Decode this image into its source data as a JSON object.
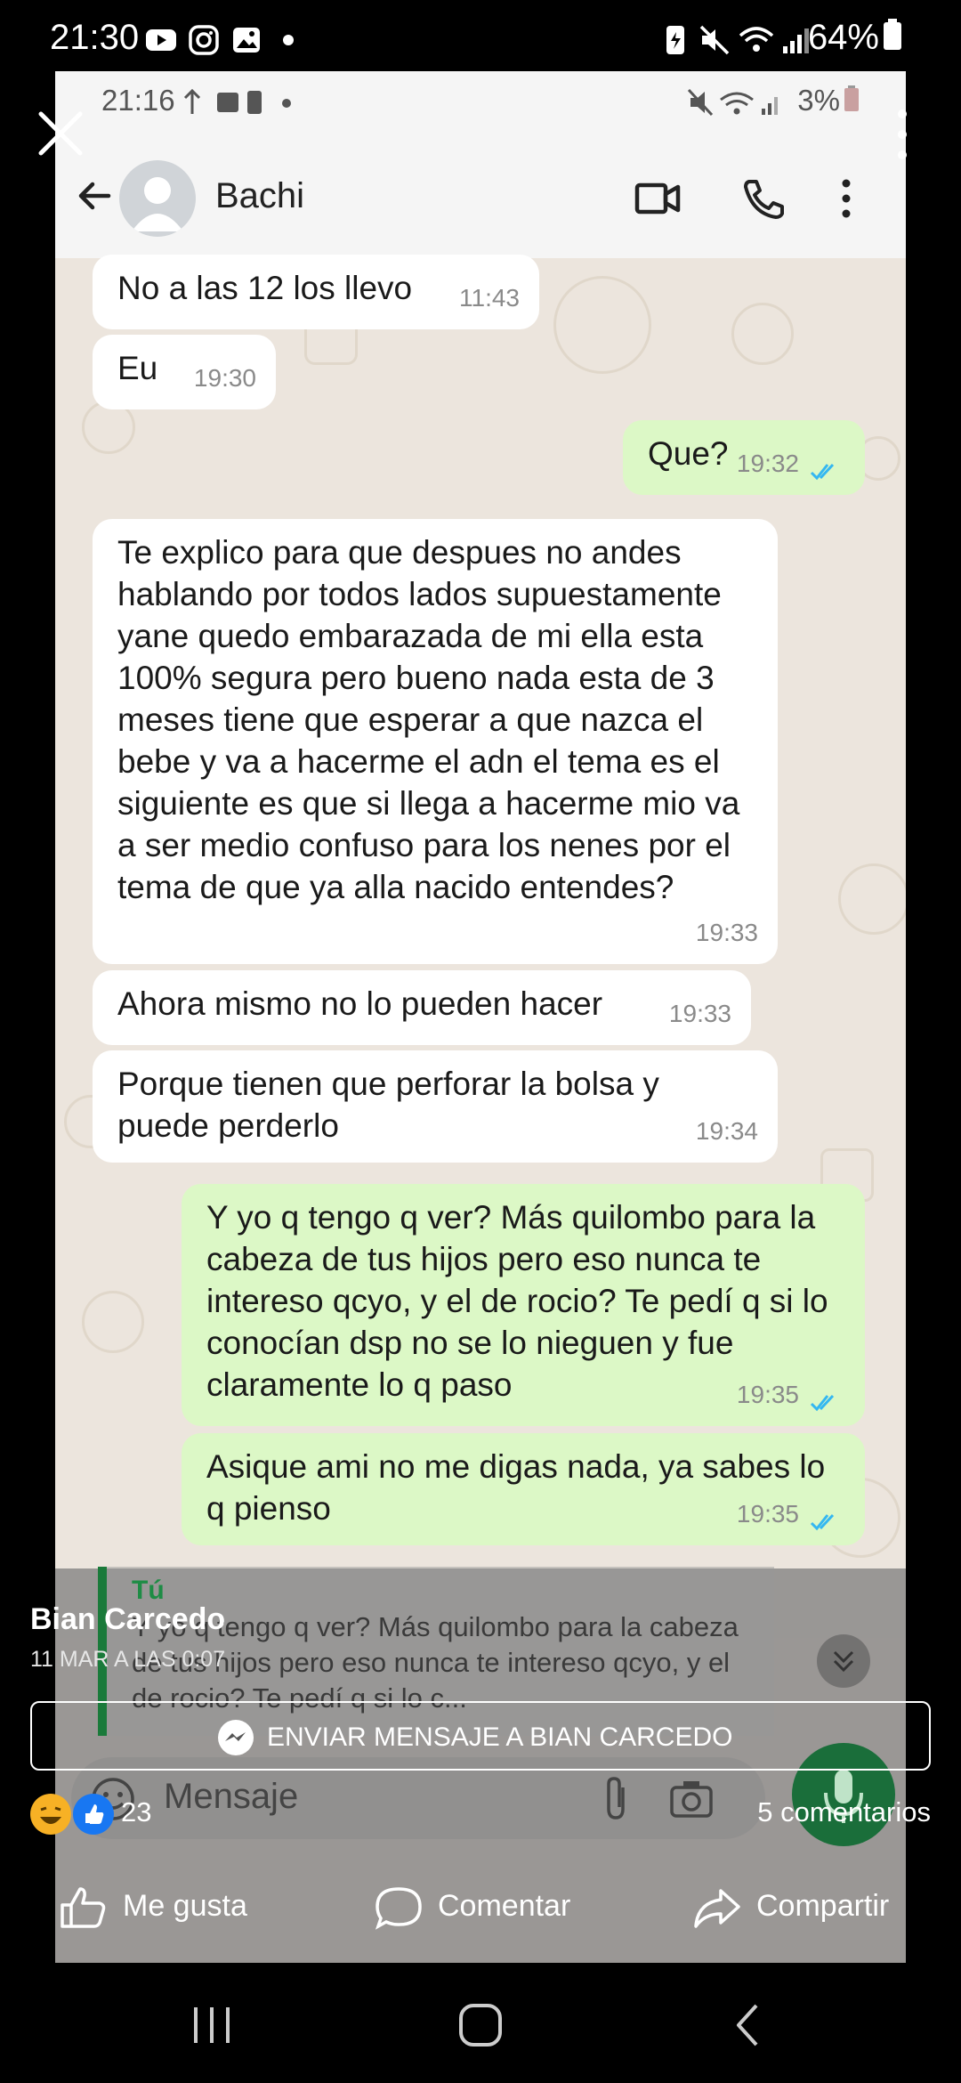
{
  "outer_status": {
    "time": "21:30",
    "battery": "64%"
  },
  "inner_status": {
    "time": "21:16",
    "battery": "3%"
  },
  "chat": {
    "contact_name": "Bachi"
  },
  "messages": [
    {
      "dir": "in",
      "text": "No a las 12 los llevo",
      "time": "11:43"
    },
    {
      "dir": "in",
      "text": "Eu",
      "time": "19:30"
    },
    {
      "dir": "out",
      "text": "Que?",
      "time": "19:32"
    },
    {
      "dir": "in",
      "text": "Te explico para que despues no andes hablando por todos lados supuestamente yane quedo embarazada de mi ella esta 100% segura pero bueno nada esta de 3 meses tiene que esperar a que nazca el bebe y va a hacerme el adn el tema es el siguiente es que si llega a hacerme mio va a ser medio confuso para los nenes por el tema de que ya alla nacido entendes?",
      "time": "19:33"
    },
    {
      "dir": "in",
      "text": "Ahora mismo no lo pueden hacer",
      "time": "19:33"
    },
    {
      "dir": "in",
      "text": "Porque tienen que perforar la bolsa y puede perderlo",
      "time": "19:34"
    },
    {
      "dir": "out",
      "text": "Y yo q tengo q ver? Más quilombo para la cabeza de tus hijos pero eso nunca te intereso qcyo, y el de rocio? Te pedí q si lo conocían dsp no se lo nieguen y fue claramente lo q paso",
      "time": "19:35"
    },
    {
      "dir": "out",
      "text": "Asique ami no me digas nada, ya sabes lo q pienso",
      "time": "19:35"
    }
  ],
  "reply_preview": {
    "author": "Tú",
    "text": "Y yo q tengo q ver? Más quilombo para la cabeza de tus hijos pero eso nunca te intereso qcyo, y el de rocio? Te pedí q si lo c..."
  },
  "input": {
    "placeholder": "Mensaje"
  },
  "post": {
    "poster_name": "Bian Carcedo",
    "date": "11 MAR A LAS 0:07",
    "send_message_label": "ENVIAR MENSAJE A BIAN CARCEDO",
    "reaction_count": "23",
    "comments": "5 comentarios",
    "like_label": "Me gusta",
    "comment_label": "Comentar",
    "share_label": "Compartir"
  },
  "colors": {
    "incoming": "#ffffff",
    "outgoing": "#dcf8c6",
    "chat_bg": "#ece5dd",
    "ticks": "#34b7f1",
    "mic": "#1a6e3a"
  }
}
